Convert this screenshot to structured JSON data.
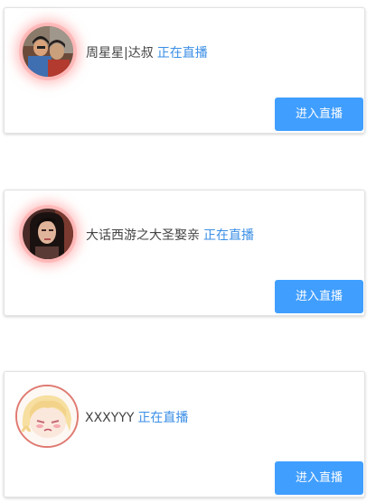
{
  "rooms": [
    {
      "name": "周星星|达叔",
      "status": "正在直播",
      "button": "进入直播",
      "avatar": "photo-avatar-two-men"
    },
    {
      "name": "大话西游之大圣娶亲",
      "status": "正在直播",
      "button": "进入直播",
      "avatar": "photo-avatar-woman"
    },
    {
      "name": "XXXYYY",
      "status": "正在直播",
      "button": "进入直播",
      "avatar": "anime-avatar-girl"
    }
  ],
  "colors": {
    "accent": "#409eff",
    "status_text": "#3a8ee6",
    "name_text": "#444444"
  }
}
